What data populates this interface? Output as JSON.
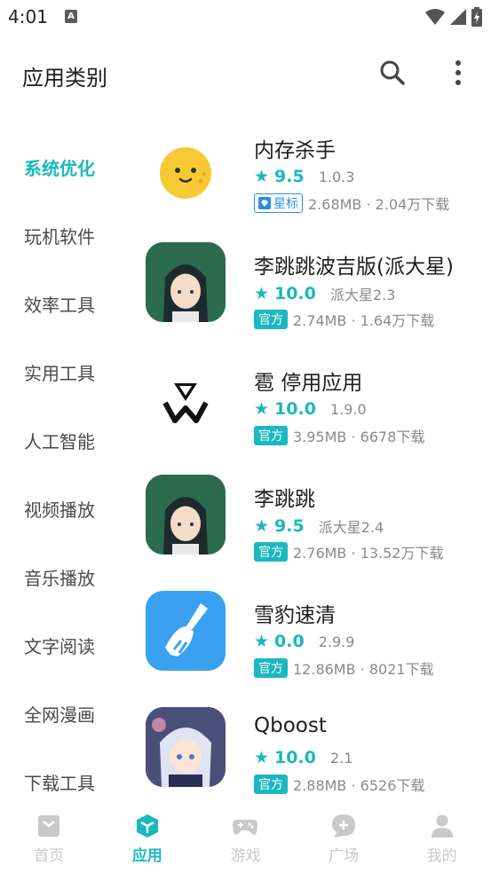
{
  "status": {
    "time": "4:01",
    "notif_letter": "A"
  },
  "header": {
    "title": "应用类别",
    "search_icon": "search-icon",
    "more_icon": "more-vert-icon"
  },
  "sidebar": {
    "items": [
      {
        "label": "系统优化",
        "active": true
      },
      {
        "label": "玩机软件"
      },
      {
        "label": "效率工具"
      },
      {
        "label": "实用工具"
      },
      {
        "label": "人工智能"
      },
      {
        "label": "视频播放"
      },
      {
        "label": "音乐播放"
      },
      {
        "label": "文字阅读"
      },
      {
        "label": "全网漫画"
      },
      {
        "label": "下载工具"
      }
    ]
  },
  "apps": [
    {
      "name": "内存杀手",
      "rating": "9.5",
      "version": "1.0.3",
      "badge": "星标",
      "size": "2.68MB · 2.04万下载",
      "icon": "smiley-face-icon"
    },
    {
      "name": "李跳跳波吉版(派大星)",
      "rating": "10.0",
      "version": "派大星2.3",
      "badge": "官方",
      "size": "2.74MB · 1.64万下载",
      "icon": "anime-girl-icon"
    },
    {
      "name": "雹 停用应用",
      "rating": "10.0",
      "version": "1.9.0",
      "badge": "官方",
      "size": "3.95MB · 6678下载",
      "icon": "hourglass-logo-icon"
    },
    {
      "name": "李跳跳",
      "rating": "9.5",
      "version": "派大星2.4",
      "badge": "官方",
      "size": "2.76MB · 13.52万下载",
      "icon": "anime-girl-icon"
    },
    {
      "name": "雪豹速清",
      "rating": "0.0",
      "version": "2.9.9",
      "badge": "官方",
      "size": "12.86MB · 8021下载",
      "icon": "broom-icon"
    },
    {
      "name": "Qboost",
      "rating": "10.0",
      "version": "2.1",
      "badge": "官方",
      "size": "2.88MB · 6526下载",
      "icon": "anime-character-icon"
    }
  ],
  "bottom_nav": {
    "items": [
      {
        "label": "首页",
        "icon": "home-icon"
      },
      {
        "label": "应用",
        "icon": "cube-icon",
        "active": true
      },
      {
        "label": "游戏",
        "icon": "gamepad-icon"
      },
      {
        "label": "广场",
        "icon": "chat-bubble-icon"
      },
      {
        "label": "我的",
        "icon": "person-icon"
      }
    ]
  },
  "colors": {
    "accent": "#1ab8c0",
    "star_badge": "#2b8fe0",
    "inactive_nav": "#c9c9c9"
  }
}
